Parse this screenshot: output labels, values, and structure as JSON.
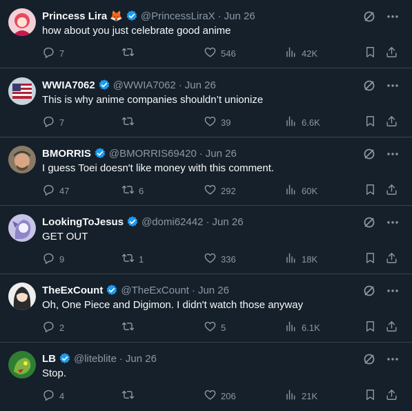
{
  "colors": {
    "background": "#15202b",
    "verified": "#1d9bf0",
    "muted": "#8b98a5",
    "divider": "#38444d"
  },
  "tweets": [
    {
      "name": "Princess Lira",
      "emoji": "🦊",
      "handle": "@PrincessLiraX",
      "date": "Jun 26",
      "text": "how about you just celebrate good anime",
      "replies": "7",
      "retweets": "",
      "likes": "546",
      "views": "42K"
    },
    {
      "name": "WWIA7062",
      "emoji": "",
      "handle": "@WWIA7062",
      "date": "Jun 26",
      "text": "This is why anime companies shouldn’t unionize",
      "replies": "7",
      "retweets": "",
      "likes": "39",
      "views": "6.6K"
    },
    {
      "name": "BMORRIS",
      "emoji": "",
      "handle": "@BMORRIS69420",
      "date": "Jun 26",
      "text": "I guess Toei doesn't like money with this comment.",
      "replies": "47",
      "retweets": "6",
      "likes": "292",
      "views": "60K"
    },
    {
      "name": "LookingToJesus",
      "emoji": "",
      "handle": "@domi62442",
      "date": "Jun 26",
      "text": "GET OUT",
      "replies": "9",
      "retweets": "1",
      "likes": "336",
      "views": "18K"
    },
    {
      "name": "TheExCount",
      "emoji": "",
      "handle": "@TheExCount",
      "date": "Jun 26",
      "text": "Oh, One Piece and Digimon. I didn't watch those anyway",
      "replies": "2",
      "retweets": "",
      "likes": "5",
      "views": "6.1K"
    },
    {
      "name": "LB",
      "emoji": "",
      "handle": "@liteblite",
      "date": "Jun 26",
      "text": "Stop.",
      "replies": "4",
      "retweets": "",
      "likes": "206",
      "views": "21K"
    }
  ]
}
